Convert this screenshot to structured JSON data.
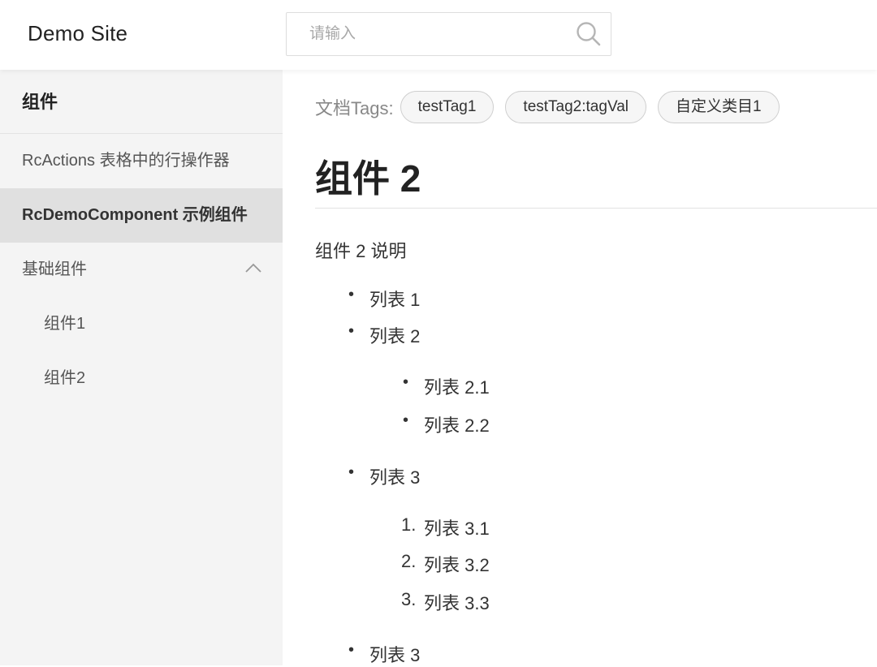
{
  "header": {
    "site_title": "Demo Site",
    "search": {
      "placeholder": "请输入",
      "value": "",
      "icon": "search-icon"
    }
  },
  "sidebar": {
    "heading": "组件",
    "items": [
      {
        "label": "RcActions 表格中的行操作器",
        "active": false
      },
      {
        "label": "RcDemoComponent 示例组件",
        "active": true
      },
      {
        "label": "基础组件",
        "expanded": true,
        "icon": "chevron-up-icon"
      }
    ],
    "sub_items": [
      {
        "label": "组件1"
      },
      {
        "label": "组件2"
      }
    ]
  },
  "content": {
    "tags_label": "文档Tags:",
    "tags": [
      "testTag1",
      "testTag2:tagVal",
      "自定义类目1"
    ],
    "title": "组件 2",
    "description": "组件 2 说明",
    "list": [
      {
        "text": "列表 1"
      },
      {
        "text": "列表 2"
      },
      {
        "text": "列表 2.1"
      },
      {
        "text": "列表 2.2"
      },
      {
        "text": "列表 3"
      },
      {
        "marker": "1.",
        "text": "列表 3.1"
      },
      {
        "marker": "2.",
        "text": "列表 3.2"
      },
      {
        "marker": "3.",
        "text": "列表 3.3"
      },
      {
        "text": "列表 3"
      }
    ]
  },
  "colors": {
    "sidebar_bg": "#f4f4f4",
    "active_item_bg": "#e0e0e0",
    "text": "#333333",
    "muted_text": "#888888",
    "tag_border": "#cfcfcf"
  }
}
